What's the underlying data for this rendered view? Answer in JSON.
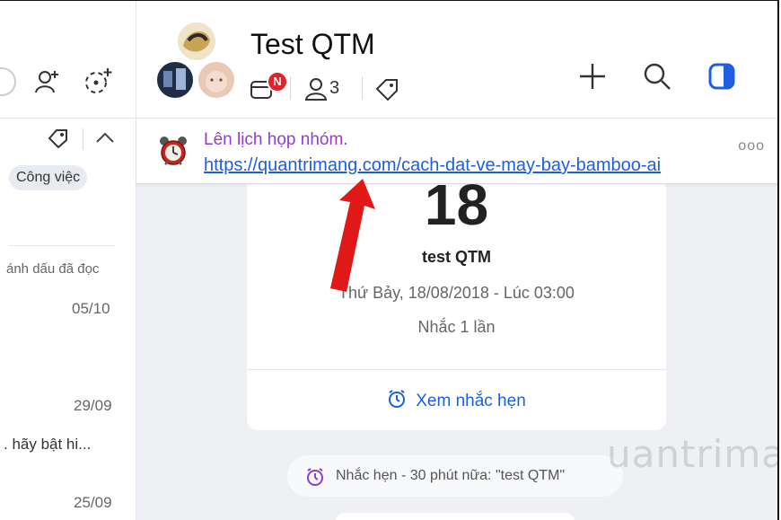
{
  "left": {
    "tag_label": "Công việc",
    "mark_read": "ánh dấu đã đọc",
    "dates": [
      "05/10",
      "29/09",
      "25/09"
    ],
    "snippet": ". hãy bật hi..."
  },
  "header": {
    "title": "Test QTM",
    "notification_badge": "N",
    "member_count": "3"
  },
  "pinned": {
    "title": "Lên lịch họp nhóm.",
    "link": "https://quantrimang.com/cach-dat-ve-may-bay-bamboo-ai",
    "more": "ooo"
  },
  "reminder_card": {
    "big_number": "18",
    "name": "test QTM",
    "datetime": "Thứ Bảy, 18/08/2018 - Lúc 03:00",
    "repeat": "Nhắc 1 lần",
    "action_label": "Xem nhắc hẹn"
  },
  "system_message": "Nhắc hẹn - 30 phút nữa: \"test QTM\"",
  "watermark": "uantrimang",
  "colors": {
    "accent_blue": "#1d5fe0",
    "purple": "#8f3fd0",
    "badge_red": "#e4222b",
    "arrow_red": "#e01818"
  },
  "icons": [
    "add-friend-icon",
    "create-group-icon",
    "tag-icon",
    "chevron-up-icon",
    "alarm-clock-icon",
    "plus-icon",
    "search-icon",
    "sidebar-toggle-icon",
    "member-icon",
    "calendar-icon",
    "clock-icon"
  ]
}
